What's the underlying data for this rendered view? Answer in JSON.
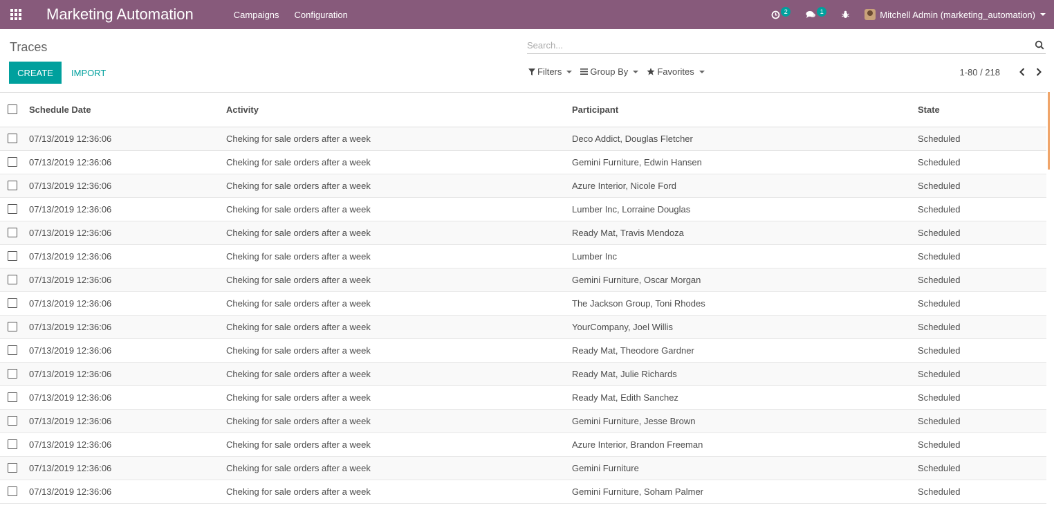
{
  "navbar": {
    "app_title": "Marketing Automation",
    "menus": [
      "Campaigns",
      "Configuration"
    ],
    "activity_count": "2",
    "messages_count": "1",
    "user_name": "Mitchell Admin (marketing_automation)"
  },
  "control_panel": {
    "breadcrumb": "Traces",
    "create_label": "CREATE",
    "import_label": "IMPORT",
    "search_placeholder": "Search...",
    "filters_label": "Filters",
    "group_by_label": "Group By",
    "favorites_label": "Favorites",
    "pager_value": "1-80 / 218"
  },
  "table": {
    "headers": {
      "schedule_date": "Schedule Date",
      "activity": "Activity",
      "participant": "Participant",
      "state": "State"
    },
    "rows": [
      {
        "date": "07/13/2019 12:36:06",
        "activity": "Cheking for sale orders after a week",
        "participant": "Deco Addict, Douglas Fletcher",
        "state": "Scheduled"
      },
      {
        "date": "07/13/2019 12:36:06",
        "activity": "Cheking for sale orders after a week",
        "participant": "Gemini Furniture, Edwin Hansen",
        "state": "Scheduled"
      },
      {
        "date": "07/13/2019 12:36:06",
        "activity": "Cheking for sale orders after a week",
        "participant": "Azure Interior, Nicole Ford",
        "state": "Scheduled"
      },
      {
        "date": "07/13/2019 12:36:06",
        "activity": "Cheking for sale orders after a week",
        "participant": "Lumber Inc, Lorraine Douglas",
        "state": "Scheduled"
      },
      {
        "date": "07/13/2019 12:36:06",
        "activity": "Cheking for sale orders after a week",
        "participant": "Ready Mat, Travis Mendoza",
        "state": "Scheduled"
      },
      {
        "date": "07/13/2019 12:36:06",
        "activity": "Cheking for sale orders after a week",
        "participant": "Lumber Inc",
        "state": "Scheduled"
      },
      {
        "date": "07/13/2019 12:36:06",
        "activity": "Cheking for sale orders after a week",
        "participant": "Gemini Furniture, Oscar Morgan",
        "state": "Scheduled"
      },
      {
        "date": "07/13/2019 12:36:06",
        "activity": "Cheking for sale orders after a week",
        "participant": "The Jackson Group, Toni Rhodes",
        "state": "Scheduled"
      },
      {
        "date": "07/13/2019 12:36:06",
        "activity": "Cheking for sale orders after a week",
        "participant": "YourCompany, Joel Willis",
        "state": "Scheduled"
      },
      {
        "date": "07/13/2019 12:36:06",
        "activity": "Cheking for sale orders after a week",
        "participant": "Ready Mat, Theodore Gardner",
        "state": "Scheduled"
      },
      {
        "date": "07/13/2019 12:36:06",
        "activity": "Cheking for sale orders after a week",
        "participant": "Ready Mat, Julie Richards",
        "state": "Scheduled"
      },
      {
        "date": "07/13/2019 12:36:06",
        "activity": "Cheking for sale orders after a week",
        "participant": "Ready Mat, Edith Sanchez",
        "state": "Scheduled"
      },
      {
        "date": "07/13/2019 12:36:06",
        "activity": "Cheking for sale orders after a week",
        "participant": "Gemini Furniture, Jesse Brown",
        "state": "Scheduled"
      },
      {
        "date": "07/13/2019 12:36:06",
        "activity": "Cheking for sale orders after a week",
        "participant": "Azure Interior, Brandon Freeman",
        "state": "Scheduled"
      },
      {
        "date": "07/13/2019 12:36:06",
        "activity": "Cheking for sale orders after a week",
        "participant": "Gemini Furniture",
        "state": "Scheduled"
      },
      {
        "date": "07/13/2019 12:36:06",
        "activity": "Cheking for sale orders after a week",
        "participant": "Gemini Furniture, Soham Palmer",
        "state": "Scheduled"
      }
    ]
  },
  "colors": {
    "navbar": "#875a7b",
    "primary": "#00a09d",
    "scroll_indicator": "#f0a56a"
  },
  "icons": [
    "apps-icon",
    "activity-clock-icon",
    "messages-icon",
    "debug-bug-icon",
    "search-icon",
    "filter-icon",
    "group-by-icon",
    "favorites-star-icon",
    "pager-prev-icon",
    "pager-next-icon"
  ]
}
